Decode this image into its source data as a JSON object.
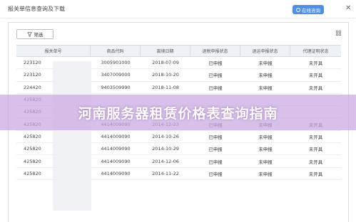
{
  "window": {
    "title": "报关单信息查询及下载",
    "online_button": "在线咨询"
  },
  "toolbar": {
    "filter_label": "筛选"
  },
  "table": {
    "columns": [
      "报关单号",
      "商品代码",
      "离境日期",
      "退税申报状态",
      "退运申报状态",
      "代理证明状态"
    ],
    "rows": [
      [
        "223120",
        "3005901000",
        "2018-07-09",
        "已申报",
        "未申报",
        "未开具"
      ],
      [
        "223120",
        "3407009000",
        "2018-10-20",
        "已申报",
        "未申报",
        "未开具"
      ],
      [
        "224420",
        "9403509990",
        "2018-11-08",
        "已申报",
        "未申报",
        "未开具"
      ],
      [
        "425820",
        "",
        "",
        "",
        "",
        ""
      ],
      [
        "425820",
        "",
        "",
        "",
        "",
        ""
      ],
      [
        "425820",
        "4414009090",
        "2014-12-23",
        "已申报",
        "未申报",
        "未开具"
      ],
      [
        "425820",
        "4414009090",
        "2014-10-26",
        "已申报",
        "未申报",
        "未开具"
      ],
      [
        "425820",
        "4414009090",
        "2014-10-29",
        "已申报",
        "未申报",
        "未开具"
      ],
      [
        "425820",
        "4414009090",
        "2014-12-06",
        "已申报",
        "未申报",
        "未开具"
      ],
      [
        "425820",
        "4414009090",
        "2014-11-22",
        "已申报",
        "未申报",
        "未开具"
      ]
    ]
  },
  "overlay": {
    "banner_text": "河南服务器租赁价格表查询指南"
  }
}
